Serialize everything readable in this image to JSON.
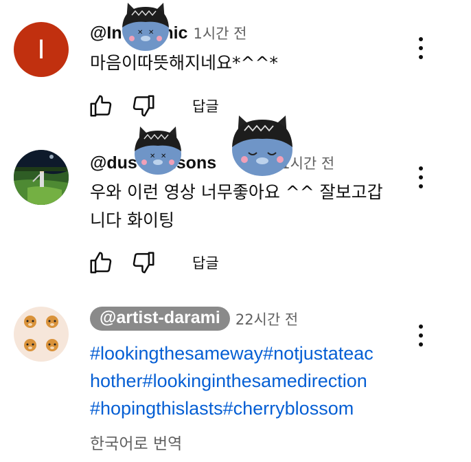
{
  "comments": [
    {
      "handle": "@In      Chic",
      "time": "1시간 전",
      "text": "마음이따뜻해지네요*^^*",
      "avatar_letter": "I",
      "reply_label": "답글"
    },
    {
      "handle": "@dus      nsons     oti...",
      "time": "1시간 전",
      "text_line1": "우와 이런 영상 너무좋아요 ^^ 잘보고갑",
      "text_line2": "니다 화이팅",
      "reply_label": "답글"
    },
    {
      "handle": "@artist-darami",
      "time": "22시간 전",
      "tags_line1": "#lookingthesameway#notjustateac",
      "tags_line2": "hother#lookinginthesamedirection",
      "tags_line3": "#hopingthislasts#cherryblossom",
      "translate_label": "한국어로 번역"
    }
  ],
  "colors": {
    "link": "#065fd4",
    "secondary_text": "#606060",
    "avatar_bg": "#c1300f",
    "pill_bg": "#8a8a8a"
  }
}
